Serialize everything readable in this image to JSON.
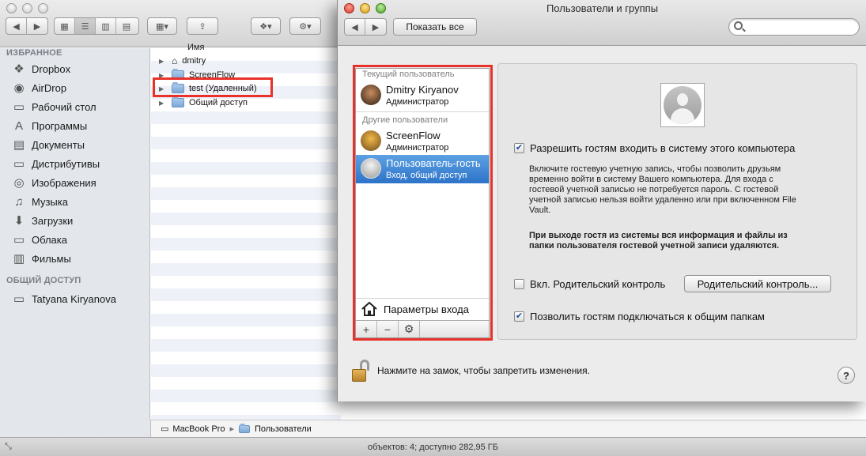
{
  "finder": {
    "sidebar": {
      "favorites_header": "ИЗБРАННОЕ",
      "favorites": [
        {
          "label": "Dropbox",
          "icon": "dropbox-icon"
        },
        {
          "label": "AirDrop",
          "icon": "airdrop-icon"
        },
        {
          "label": "Рабочий стол",
          "icon": "desktop-icon"
        },
        {
          "label": "Программы",
          "icon": "applications-icon"
        },
        {
          "label": "Документы",
          "icon": "documents-icon"
        },
        {
          "label": "Дистрибутивы",
          "icon": "folder-icon"
        },
        {
          "label": "Изображения",
          "icon": "pictures-icon"
        },
        {
          "label": "Музыка",
          "icon": "music-icon"
        },
        {
          "label": "Загрузки",
          "icon": "downloads-icon"
        },
        {
          "label": "Облака",
          "icon": "folder-icon"
        },
        {
          "label": "Фильмы",
          "icon": "movies-icon"
        }
      ],
      "shared_header": "ОБЩИЙ ДОСТУП",
      "shared": [
        {
          "label": "Tatyana Kiryanova",
          "icon": "computer-icon"
        }
      ]
    },
    "list": {
      "column_name": "Имя",
      "rows": [
        {
          "label": "dmitry",
          "icon": "home-folder-icon"
        },
        {
          "label": "ScreenFlow",
          "icon": "folder-icon"
        },
        {
          "label": "test (Удаленный)",
          "icon": "folder-icon"
        },
        {
          "label": "Общий доступ",
          "icon": "folder-icon"
        }
      ]
    },
    "path": {
      "disk": "MacBook Pro",
      "folder": "Пользователи"
    },
    "status": "объектов: 4; доступно 282,95 ГБ"
  },
  "prefs": {
    "title": "Пользователи и группы",
    "show_all": "Показать все",
    "search_placeholder": "",
    "current_user_header": "Текущий пользователь",
    "other_users_header": "Другие пользователи",
    "users": [
      {
        "name": "Dmitry Kiryanov",
        "role": "Администратор"
      },
      {
        "name": "ScreenFlow",
        "role": "Администратор"
      },
      {
        "name": "Пользователь-гость",
        "role": "Вход, общий доступ"
      }
    ],
    "login_options": "Параметры входа",
    "allow_guests_label": "Разрешить гостям входить в систему этого компьютера",
    "allow_guests_checked": true,
    "guest_desc": "Включите гостевую учетную запись, чтобы позволить друзьям временно войти в систему Вашего компьютера. Для входа с гостевой учетной записью не потребуется пароль. С гостевой учетной записью нельзя войти удаленно или при включенном File Vault.",
    "guest_warning": "При выходе гостя из системы вся информация и файлы из папки пользователя гостевой учетной записи удаляются.",
    "parental_label": "Вкл. Родительский контроль",
    "parental_checked": false,
    "parental_button": "Родительский контроль...",
    "shared_folders_label": "Позволить гостям подключаться к общим папкам",
    "shared_folders_checked": true,
    "lock_text": "Нажмите на замок, чтобы запретить изменения.",
    "help": "?"
  },
  "colors": {
    "highlight_red": "#e8312b",
    "selection_blue": "#2d73c8"
  }
}
